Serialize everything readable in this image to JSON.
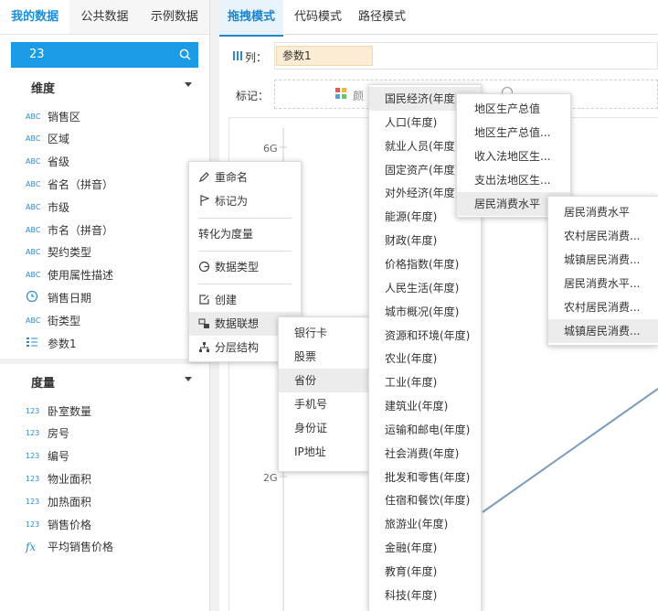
{
  "left_tabs": [
    "我的数据",
    "公共数据",
    "示例数据"
  ],
  "search": {
    "value": "23"
  },
  "dimension": {
    "title": "维度",
    "fields": [
      {
        "type": "ABC",
        "label": "销售区"
      },
      {
        "type": "ABC",
        "label": "区域"
      },
      {
        "type": "ABC",
        "label": "省级"
      },
      {
        "type": "ABC",
        "label": "省名（拼音）"
      },
      {
        "type": "ABC",
        "label": "市级"
      },
      {
        "type": "ABC",
        "label": "市名（拼音）"
      },
      {
        "type": "ABC",
        "label": "契约类型"
      },
      {
        "type": "ABC",
        "label": "使用属性描述"
      },
      {
        "type": "clock",
        "label": "销售日期"
      },
      {
        "type": "ABC",
        "label": "街类型"
      },
      {
        "type": "param",
        "label": "参数1"
      }
    ]
  },
  "measure": {
    "title": "度量",
    "fields": [
      {
        "type": "123",
        "label": "卧室数量"
      },
      {
        "type": "123",
        "label": "房号"
      },
      {
        "type": "123",
        "label": "编号"
      },
      {
        "type": "123",
        "label": "物业面积"
      },
      {
        "type": "123",
        "label": "加热面积"
      },
      {
        "type": "123",
        "label": "销售价格"
      },
      {
        "type": "fx",
        "label": "平均销售价格"
      }
    ]
  },
  "main_tabs": [
    "拖拽模式",
    "代码模式",
    "路径模式"
  ],
  "columns": {
    "label": "列：",
    "chip": "参数1"
  },
  "marks": {
    "label": "标记：",
    "partial": "颜"
  },
  "axis": [
    "6G",
    "2G"
  ],
  "context_menu": {
    "items": [
      "重命名",
      "标记为",
      "转化为度量",
      "数据类型",
      "创建",
      "数据联想",
      "分层结构"
    ]
  },
  "assoc_menu": [
    "银行卡",
    "股票",
    "省份",
    "手机号",
    "身份证",
    "IP地址"
  ],
  "stat_menu": [
    "国民经济(年度)",
    "人口(年度)",
    "就业人员(年度)",
    "固定资产(年度)",
    "对外经济(年度)",
    "能源(年度)",
    "财政(年度)",
    "价格指数(年度)",
    "人民生活(年度)",
    "城市概况(年度)",
    "资源和环境(年度)",
    "农业(年度)",
    "工业(年度)",
    "建筑业(年度)",
    "运输和邮电(年度)",
    "社会消费(年度)",
    "批发和零售(年度)",
    "住宿和餐饮(年度)",
    "旅游业(年度)",
    "金融(年度)",
    "教育(年度)",
    "科技(年度)"
  ],
  "gdp_menu": [
    "地区生产总值",
    "地区生产总值...",
    "收入法地区生...",
    "支出法地区生...",
    "居民消费水平"
  ],
  "consume_menu": [
    "居民消费水平",
    "农村居民消费...",
    "城镇居民消费...",
    "居民消费水平...",
    "农村居民消费...",
    "城镇居民消费..."
  ],
  "colors": {
    "accent": "#1b9ae6",
    "tab_active": "#1c8fd9",
    "chip": "#fcecd3",
    "line": "#7a9cbd"
  }
}
